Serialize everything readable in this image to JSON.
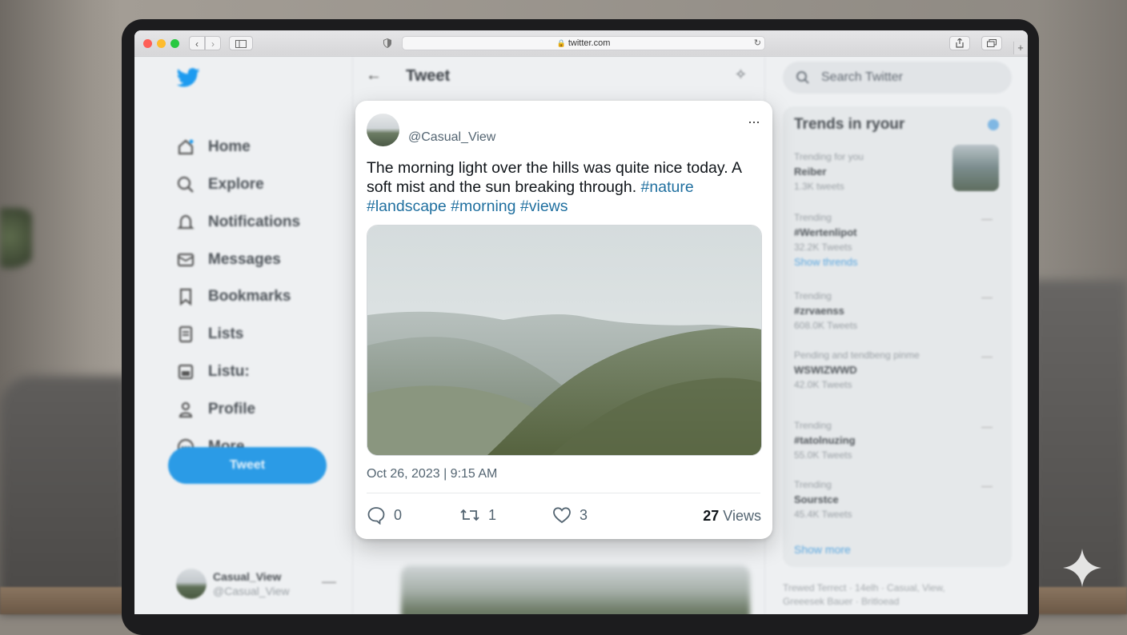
{
  "browser": {
    "url": "twitter.com",
    "back_label": "‹",
    "forward_label": "›",
    "reload_label": "↻",
    "new_tab_label": "+"
  },
  "left_nav": {
    "items": [
      {
        "label": "Home",
        "icon": "home-icon"
      },
      {
        "label": "Explore",
        "icon": "search-icon"
      },
      {
        "label": "Notifications",
        "icon": "bell-icon"
      },
      {
        "label": "Messages",
        "icon": "mail-icon"
      },
      {
        "label": "Bookmarks",
        "icon": "bookmark-icon"
      },
      {
        "label": "Lists",
        "icon": "list-icon"
      },
      {
        "label": "Listu:",
        "icon": "calendar-icon"
      },
      {
        "label": "Profile",
        "icon": "person-icon"
      },
      {
        "label": "More",
        "icon": "more-circle-icon"
      }
    ],
    "tweet_button": "Tweet",
    "account_name": "Casual_View",
    "account_handle": "@Casual_View",
    "account_menu": "—"
  },
  "center": {
    "back_arrow": "←",
    "title": "Tweet"
  },
  "tweet": {
    "handle": "@Casual_View",
    "more": "···",
    "text": "The morning light over the hills was quite nice today. A soft mist and the sun breaking through.",
    "hashtags": [
      "#nature",
      "#landscape",
      "#morning",
      "#views"
    ],
    "timestamp": "Oct 26, 2023 | 9:15 AM",
    "replies": "0",
    "retweets": "1",
    "likes": "3",
    "views_count": "27",
    "views_label": "Views"
  },
  "right": {
    "search_placeholder": "Search Twitter",
    "trends_title": "Trends in ryour",
    "trends": [
      {
        "context": "Trending for you",
        "name": "Reiber",
        "count": "1.3K tweets",
        "link": ""
      },
      {
        "context": "Trending",
        "name": "#Wertenlipot",
        "count": "32.2K Tweets",
        "link": "Show thrends"
      },
      {
        "context": "Trending",
        "name": "#zrvaenss",
        "count": "608.0K Tweets",
        "link": ""
      },
      {
        "context": "Pending and tendbeng pinme",
        "name": "WSWIZWWD",
        "count": "42.0K Tweets",
        "link": ""
      },
      {
        "context": "Trending",
        "name": "#tatolnuzing",
        "count": "55.0K Tweets",
        "link": ""
      },
      {
        "context": "Trending",
        "name": "Sourstce",
        "count": "45.4K Tweets",
        "link": ""
      }
    ],
    "show_more": "Show more",
    "footer": "Trewed Terrect · 14elh · Casual, View, Greeesek Bauer · Britloead"
  },
  "colors": {
    "accent": "#1d9bf0",
    "hashtag": "#1f6f9f",
    "tweet_button": "#2b9be6"
  }
}
